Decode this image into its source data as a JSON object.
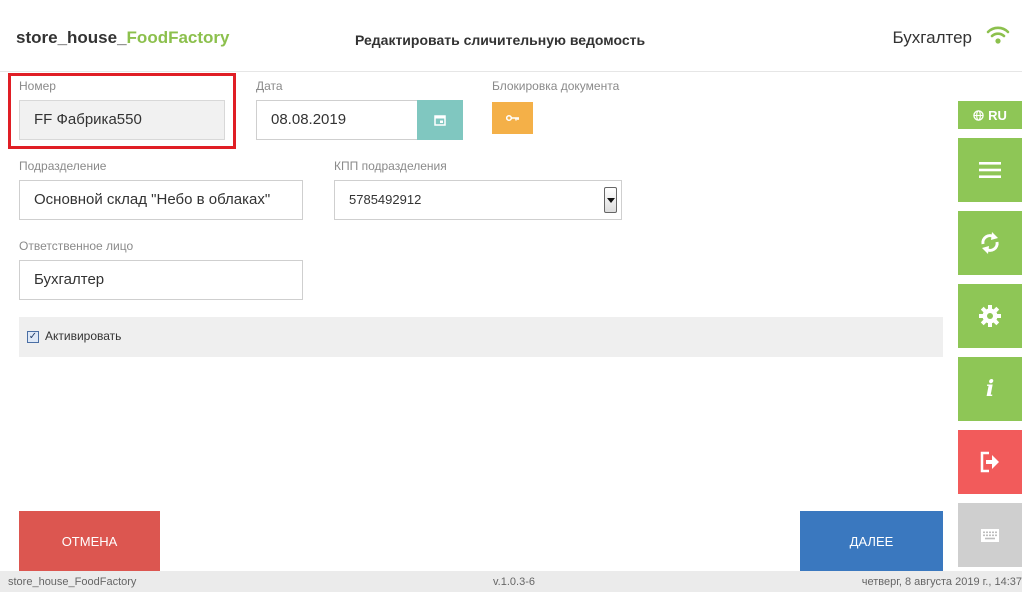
{
  "header": {
    "brand_prefix": "store_house_",
    "brand_accent": "FoodFactory",
    "title": "Редактировать сличительную ведомость",
    "user": "Бухгалтер"
  },
  "form": {
    "number_label": "Номер",
    "number_value": "FF Фабрика550",
    "date_label": "Дата",
    "date_value": "08.08.2019",
    "lock_label": "Блокировка документа",
    "division_label": "Подразделение",
    "division_value": "Основной склад \"Небо в облаках\"",
    "kpp_label": "КПП подразделения",
    "kpp_value": "5785492912",
    "responsible_label": "Ответственное лицо",
    "responsible_value": "Бухгалтер",
    "activate_label": "Активировать",
    "activate_checked": true
  },
  "buttons": {
    "cancel": "ОТМЕНА",
    "next": "ДАЛЕЕ"
  },
  "sidebar": {
    "lang": "RU",
    "icons": [
      "menu-icon",
      "sync-icon",
      "gear-icon",
      "info-icon",
      "logout-icon",
      "keyboard-icon"
    ]
  },
  "footer": {
    "app": "store_house_FoodFactory",
    "version": "v.1.0.3-6",
    "datetime": "четверг, 8 августа 2019 г., 14:37"
  },
  "colors": {
    "accent_green": "#8cc04d",
    "cancel_red": "#dc5650",
    "next_blue": "#3a78bf",
    "calendar_teal": "#80c7c0",
    "lock_orange": "#f4b048",
    "logout_red": "#f25b5b",
    "highlight_red": "#e01e25"
  }
}
